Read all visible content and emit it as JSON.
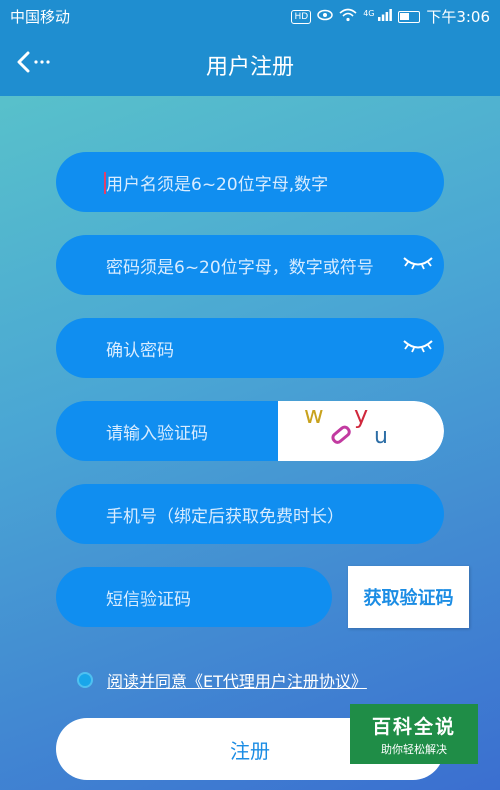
{
  "status_bar": {
    "carrier": "中国移动",
    "hd": "HD",
    "network": "4G",
    "time": "下午3:06"
  },
  "header": {
    "title": "用户注册"
  },
  "form": {
    "username_placeholder": "用户名须是6~20位字母,数字",
    "password_placeholder": "密码须是6~20位字母，数字或符号",
    "confirm_placeholder": "确认密码",
    "captcha_placeholder": "请输入验证码",
    "phone_placeholder": "手机号（绑定后获取免费时长）",
    "sms_placeholder": "短信验证码",
    "get_code_label": "获取验证码",
    "captcha_chars": [
      "w",
      "y",
      "u"
    ]
  },
  "agreement": {
    "text": "阅读并同意《ET代理用户注册协议》",
    "checked": true
  },
  "register_label": "注册",
  "watermark": {
    "title": "百科全说",
    "subtitle": "助你轻松解决"
  },
  "colors": {
    "accent": "#1f8ed0",
    "field": "#108ef0",
    "button_text": "#1c8de4"
  },
  "icons": [
    "back-arrow-icon",
    "eye-closed-icon",
    "wifi-icon",
    "signal-icon",
    "battery-icon",
    "eye-status-icon"
  ]
}
